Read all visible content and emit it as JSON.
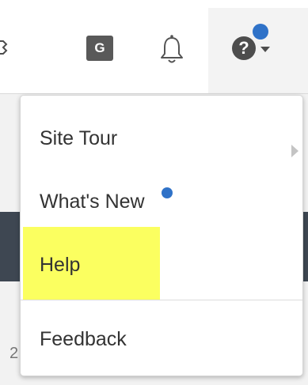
{
  "topbar": {
    "icons": {
      "gear": "gear-icon",
      "g_badge": "G",
      "bell": "bell-icon",
      "help": "?",
      "caret": "caret-down-icon"
    },
    "notification_dot_color": "#2f72c8",
    "help_button_bg": "#f3f3f3"
  },
  "menu": {
    "items": [
      {
        "label": "Site Tour",
        "has_submenu": true
      },
      {
        "label": "What's New",
        "has_new_indicator": true
      },
      {
        "label": "Help",
        "highlighted": true,
        "highlight_color": "#fbff60"
      },
      {
        "label": "Feedback"
      }
    ]
  },
  "background": {
    "partial_digit": "2",
    "band_color": "#3e4752"
  }
}
